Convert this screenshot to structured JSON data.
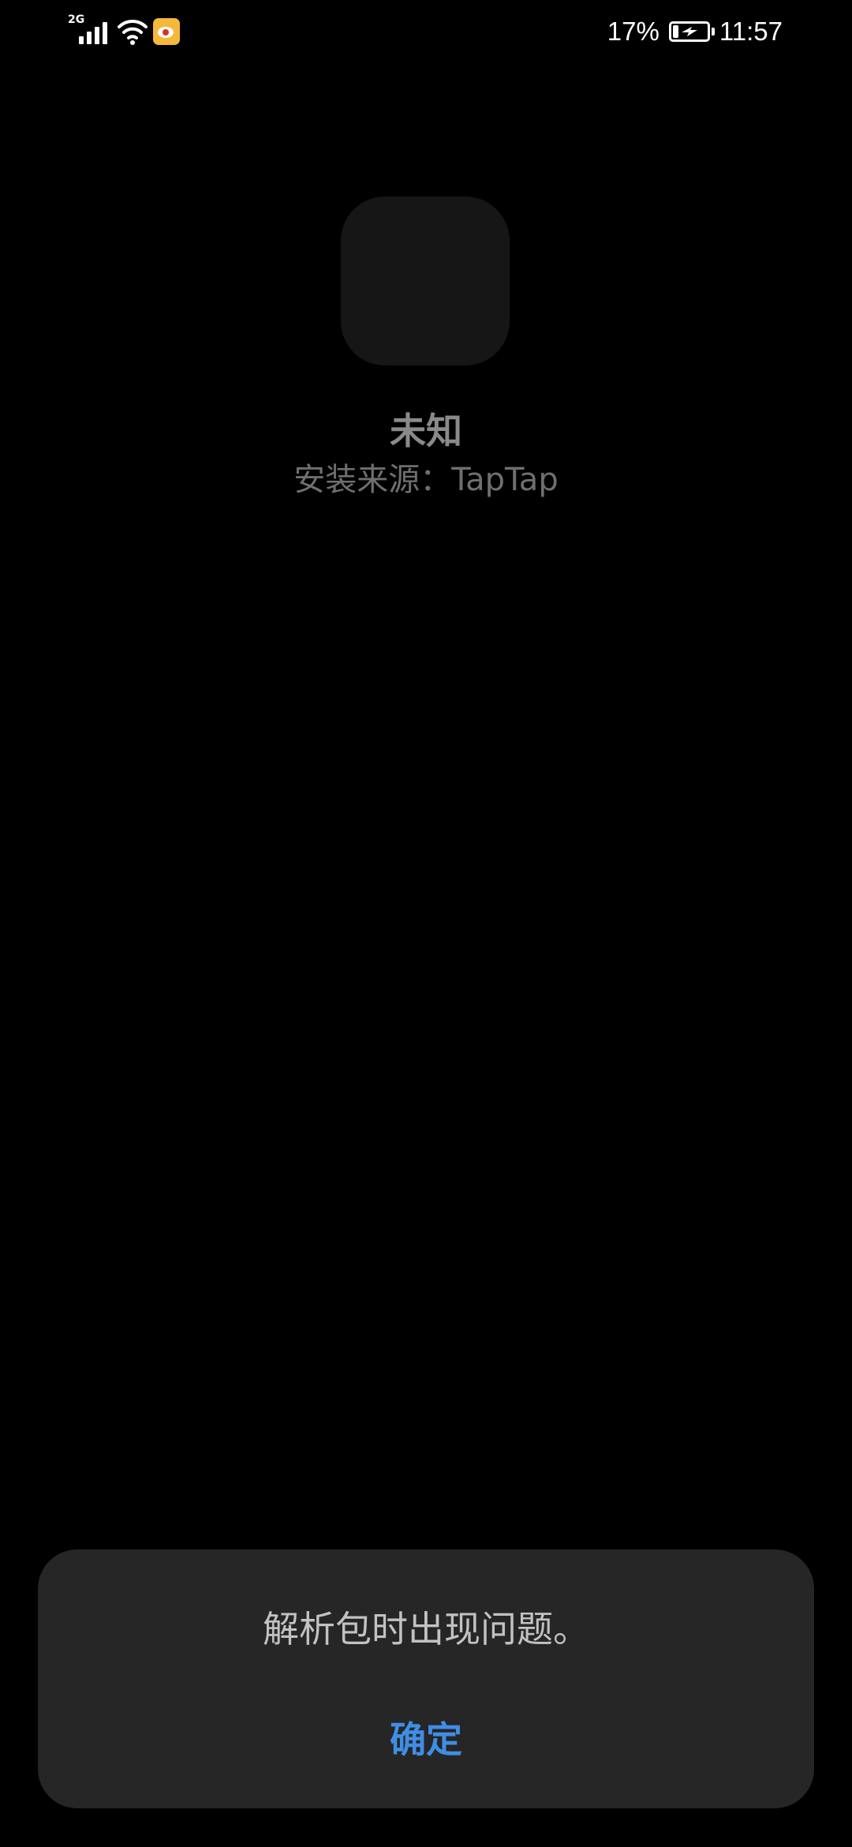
{
  "status_bar": {
    "network_type": "2G",
    "battery_percent_label": "17%",
    "battery_level": 0.17,
    "time": "11:57",
    "icons": [
      "signal-icon",
      "wifi-icon",
      "weibo-icon",
      "battery-charging-icon"
    ]
  },
  "app": {
    "name": "未知",
    "install_source": "安装来源：TapTap"
  },
  "dialog": {
    "message": "解析包时出现问题。",
    "confirm_label": "确定"
  },
  "colors": {
    "background": "#000000",
    "dialog_background": "#262626",
    "accent": "#3f8ee6"
  }
}
